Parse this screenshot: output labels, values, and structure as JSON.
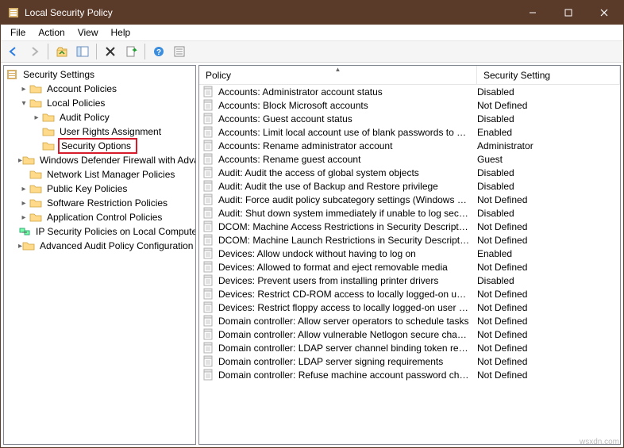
{
  "title": "Local Security Policy",
  "menus": [
    "File",
    "Action",
    "View",
    "Help"
  ],
  "tree": {
    "root": "Security Settings",
    "items": [
      {
        "label": "Account Policies",
        "indent": 1,
        "exp": "▶",
        "icon": "folder"
      },
      {
        "label": "Local Policies",
        "indent": 1,
        "exp": "▼",
        "icon": "folder"
      },
      {
        "label": "Audit Policy",
        "indent": 2,
        "exp": "▶",
        "icon": "folder"
      },
      {
        "label": "User Rights Assignment",
        "indent": 2,
        "exp": "",
        "icon": "folder"
      },
      {
        "label": "Security Options",
        "indent": 2,
        "exp": "",
        "icon": "folder",
        "highlight": true
      },
      {
        "label": "Windows Defender Firewall with Advanced Security",
        "indent": 1,
        "exp": "▶",
        "icon": "folder"
      },
      {
        "label": "Network List Manager Policies",
        "indent": 1,
        "exp": "",
        "icon": "folder"
      },
      {
        "label": "Public Key Policies",
        "indent": 1,
        "exp": "▶",
        "icon": "folder"
      },
      {
        "label": "Software Restriction Policies",
        "indent": 1,
        "exp": "▶",
        "icon": "folder"
      },
      {
        "label": "Application Control Policies",
        "indent": 1,
        "exp": "▶",
        "icon": "folder"
      },
      {
        "label": "IP Security Policies on Local Computer",
        "indent": 1,
        "exp": "",
        "icon": "ipsec"
      },
      {
        "label": "Advanced Audit Policy Configuration",
        "indent": 1,
        "exp": "▶",
        "icon": "folder"
      }
    ]
  },
  "columns": {
    "policy": "Policy",
    "setting": "Security Setting"
  },
  "policies": [
    {
      "p": "Accounts: Administrator account status",
      "s": "Disabled"
    },
    {
      "p": "Accounts: Block Microsoft accounts",
      "s": "Not Defined"
    },
    {
      "p": "Accounts: Guest account status",
      "s": "Disabled"
    },
    {
      "p": "Accounts: Limit local account use of blank passwords to co...",
      "s": "Enabled"
    },
    {
      "p": "Accounts: Rename administrator account",
      "s": "Administrator"
    },
    {
      "p": "Accounts: Rename guest account",
      "s": "Guest"
    },
    {
      "p": "Audit: Audit the access of global system objects",
      "s": "Disabled"
    },
    {
      "p": "Audit: Audit the use of Backup and Restore privilege",
      "s": "Disabled"
    },
    {
      "p": "Audit: Force audit policy subcategory settings (Windows Vis...",
      "s": "Not Defined"
    },
    {
      "p": "Audit: Shut down system immediately if unable to log secur...",
      "s": "Disabled"
    },
    {
      "p": "DCOM: Machine Access Restrictions in Security Descriptor D...",
      "s": "Not Defined"
    },
    {
      "p": "DCOM: Machine Launch Restrictions in Security Descriptor D...",
      "s": "Not Defined"
    },
    {
      "p": "Devices: Allow undock without having to log on",
      "s": "Enabled"
    },
    {
      "p": "Devices: Allowed to format and eject removable media",
      "s": "Not Defined"
    },
    {
      "p": "Devices: Prevent users from installing printer drivers",
      "s": "Disabled"
    },
    {
      "p": "Devices: Restrict CD-ROM access to locally logged-on user ...",
      "s": "Not Defined"
    },
    {
      "p": "Devices: Restrict floppy access to locally logged-on user only",
      "s": "Not Defined"
    },
    {
      "p": "Domain controller: Allow server operators to schedule tasks",
      "s": "Not Defined"
    },
    {
      "p": "Domain controller: Allow vulnerable Netlogon secure chann...",
      "s": "Not Defined"
    },
    {
      "p": "Domain controller: LDAP server channel binding token requi...",
      "s": "Not Defined"
    },
    {
      "p": "Domain controller: LDAP server signing requirements",
      "s": "Not Defined"
    },
    {
      "p": "Domain controller: Refuse machine account password chan...",
      "s": "Not Defined"
    }
  ],
  "watermark": "wsxdn.com"
}
